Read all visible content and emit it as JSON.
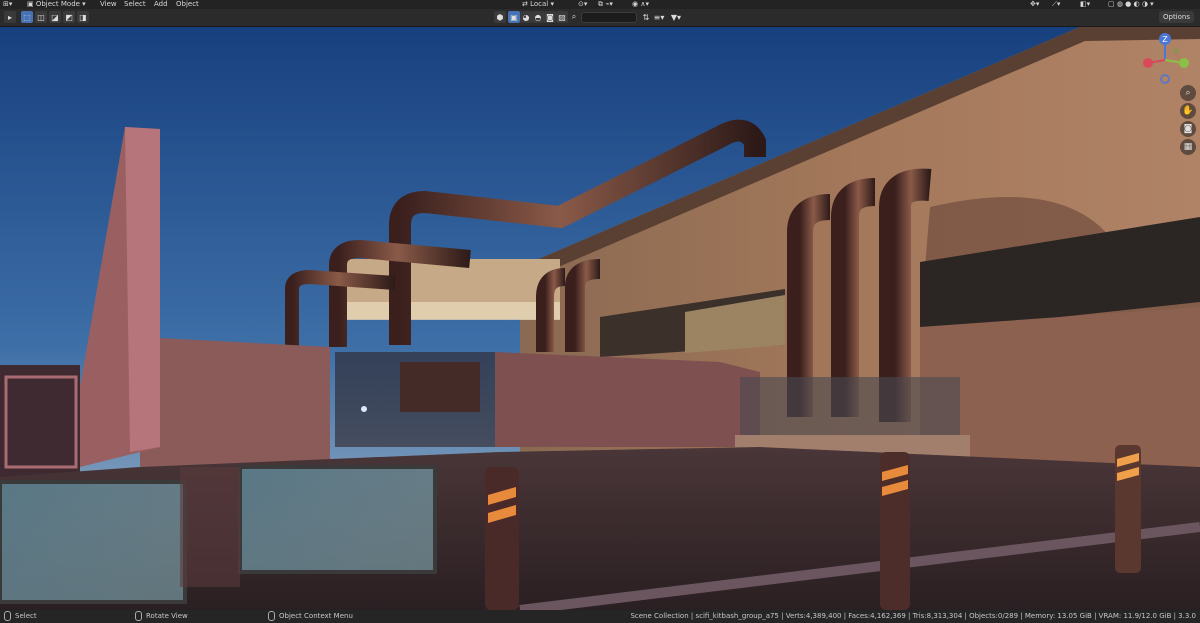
{
  "menu": {
    "editor_type_icon": "editor-type-icon",
    "mode": "Object Mode",
    "items": [
      "View",
      "Select",
      "Add",
      "Object"
    ]
  },
  "header_right": {
    "transform_orientation": "Local"
  },
  "toolbar": {
    "search_placeholder": "",
    "options_label": "Options"
  },
  "navigation": {
    "gizmo_axes": [
      "Z",
      "Y",
      "X"
    ],
    "buttons": [
      "zoom-icon",
      "hand-pan-icon",
      "camera-icon",
      "grid-icon"
    ]
  },
  "statusbar": {
    "hints": [
      {
        "action": "Select"
      },
      {
        "action": "Rotate View"
      },
      {
        "action": "Object Context Menu"
      }
    ],
    "stats": "Scene Collection | scifi_kitbash_group_a75 | Verts:4,389,400 | Faces:4,162,369 | Tris:8,313,304 | Objects:0/289 | Memory: 13.05 GiB | VRAM: 11.9/12.0 GiB | 3.3.0"
  },
  "colors": {
    "accent": "#4772b3",
    "sky_top": "#1f4f96",
    "sky_bottom": "#9fb1c4"
  }
}
